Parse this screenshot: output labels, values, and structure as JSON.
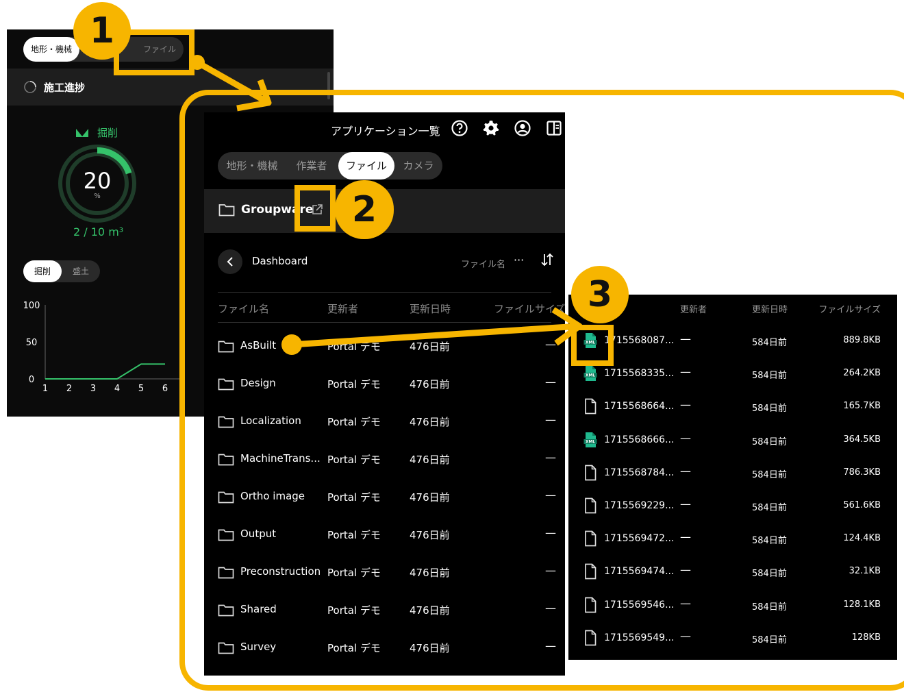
{
  "back_panel": {
    "tabs": [
      "地形・機械",
      "ファイル"
    ],
    "progress_title": "施工進捗",
    "dig_label": "掘削",
    "gauge_value": "20",
    "gauge_unit": "%",
    "gauge_fraction": 0.2,
    "volume": "2 / 10 m³",
    "segment": [
      "掘削",
      "盛土"
    ],
    "chart_data": {
      "type": "line",
      "x": [
        1,
        2,
        3,
        4,
        5,
        6
      ],
      "series": [
        {
          "values": [
            0,
            0,
            0,
            0,
            20,
            20
          ]
        }
      ],
      "ylim": [
        0,
        100
      ],
      "yticks": [
        "100",
        "50",
        "0"
      ],
      "xticks": [
        "1",
        "2",
        "3",
        "4",
        "5",
        "6"
      ]
    }
  },
  "main_panel": {
    "app_title": "アプリケーション一覧",
    "icons": [
      "help-icon",
      "gear-icon",
      "account-icon",
      "panel-icon"
    ],
    "tabs": [
      "地形・機械",
      "作業者",
      "ファイル",
      "カメラ"
    ],
    "active_tab": "ファイル",
    "folder_name": "Groupware",
    "breadcrumb": "Dashboard",
    "sort_label": "ファイル名",
    "sort_more": "···",
    "headers": {
      "name": "ファイル名",
      "updater": "更新者",
      "updated": "更新日時",
      "size": "ファイルサイズ"
    },
    "rows": [
      {
        "name": "AsBuilt",
        "updater": "Portal デモ",
        "updated": "476日前",
        "size": "—"
      },
      {
        "name": "Design",
        "updater": "Portal デモ",
        "updated": "476日前",
        "size": "—"
      },
      {
        "name": "Localization",
        "updater": "Portal デモ",
        "updated": "476日前",
        "size": "—"
      },
      {
        "name": "MachineTrans...",
        "updater": "Portal デモ",
        "updated": "476日前",
        "size": "—"
      },
      {
        "name": "Ortho image",
        "updater": "Portal デモ",
        "updated": "476日前",
        "size": "—"
      },
      {
        "name": "Output",
        "updater": "Portal デモ",
        "updated": "476日前",
        "size": "—"
      },
      {
        "name": "Preconstruction",
        "updater": "Portal デモ",
        "updated": "476日前",
        "size": "—"
      },
      {
        "name": "Shared",
        "updater": "Portal デモ",
        "updated": "476日前",
        "size": "—"
      },
      {
        "name": "Survey",
        "updater": "Portal デモ",
        "updated": "476日前",
        "size": "—"
      }
    ]
  },
  "file_panel": {
    "headers": {
      "updater": "更新者",
      "updated": "更新日時",
      "size": "ファイルサイズ"
    },
    "rows": [
      {
        "icon": "xml-file-icon",
        "name": "1715568087...",
        "updater": "—",
        "updated": "584日前",
        "size": "889.8KB"
      },
      {
        "icon": "xml-file-icon",
        "name": "1715568335...",
        "updater": "—",
        "updated": "584日前",
        "size": "264.2KB"
      },
      {
        "icon": "file-icon",
        "name": "1715568664...",
        "updater": "—",
        "updated": "584日前",
        "size": "165.7KB"
      },
      {
        "icon": "xml-file-icon",
        "name": "1715568666...",
        "updater": "—",
        "updated": "584日前",
        "size": "364.5KB"
      },
      {
        "icon": "file-icon",
        "name": "1715568784...",
        "updater": "—",
        "updated": "584日前",
        "size": "786.3KB"
      },
      {
        "icon": "file-icon",
        "name": "1715569229...",
        "updater": "—",
        "updated": "584日前",
        "size": "561.6KB"
      },
      {
        "icon": "file-icon",
        "name": "1715569472...",
        "updater": "—",
        "updated": "584日前",
        "size": "124.4KB"
      },
      {
        "icon": "file-icon",
        "name": "1715569474...",
        "updater": "—",
        "updated": "584日前",
        "size": "32.1KB"
      },
      {
        "icon": "file-icon",
        "name": "1715569546...",
        "updater": "—",
        "updated": "584日前",
        "size": "128.1KB"
      },
      {
        "icon": "file-icon",
        "name": "1715569549...",
        "updater": "—",
        "updated": "584日前",
        "size": "128KB"
      }
    ]
  },
  "annotations": {
    "step1": "1",
    "step2": "2",
    "step3": "3"
  },
  "colors": {
    "accent": "#f7b500",
    "green": "#35c26a",
    "xml_icon": "#1fb98e"
  }
}
